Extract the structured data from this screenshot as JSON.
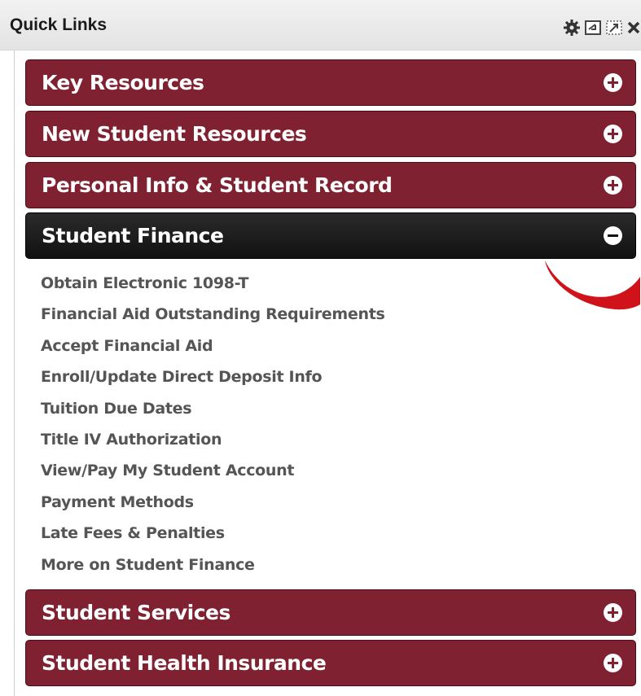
{
  "portlet": {
    "title": "Quick Links",
    "tools": [
      "gear-icon",
      "minimize-icon",
      "maximize-icon",
      "close-icon"
    ]
  },
  "sections": [
    {
      "label": "Key Resources",
      "state": "collapsed"
    },
    {
      "label": "New Student Resources",
      "state": "collapsed"
    },
    {
      "label": "Personal Info & Student Record",
      "state": "collapsed"
    },
    {
      "label": "Student Finance",
      "state": "expanded"
    },
    {
      "label": "Student Services",
      "state": "collapsed"
    },
    {
      "label": "Student Health Insurance",
      "state": "collapsed"
    }
  ],
  "finance_links": [
    "Obtain Electronic 1098-T",
    "Financial Aid Outstanding Requirements",
    "Accept Financial Aid",
    "Enroll/Update Direct Deposit Info",
    "Tuition Due Dates",
    "Title IV Authorization",
    "View/Pay My Student Account",
    "Payment Methods",
    "Late Fees & Penalties",
    "More on Student Finance"
  ],
  "colors": {
    "section_bar": "#7f2130",
    "active_bar": "#1a1a1a",
    "link_text": "#555555",
    "swoosh": "#d0121b"
  }
}
